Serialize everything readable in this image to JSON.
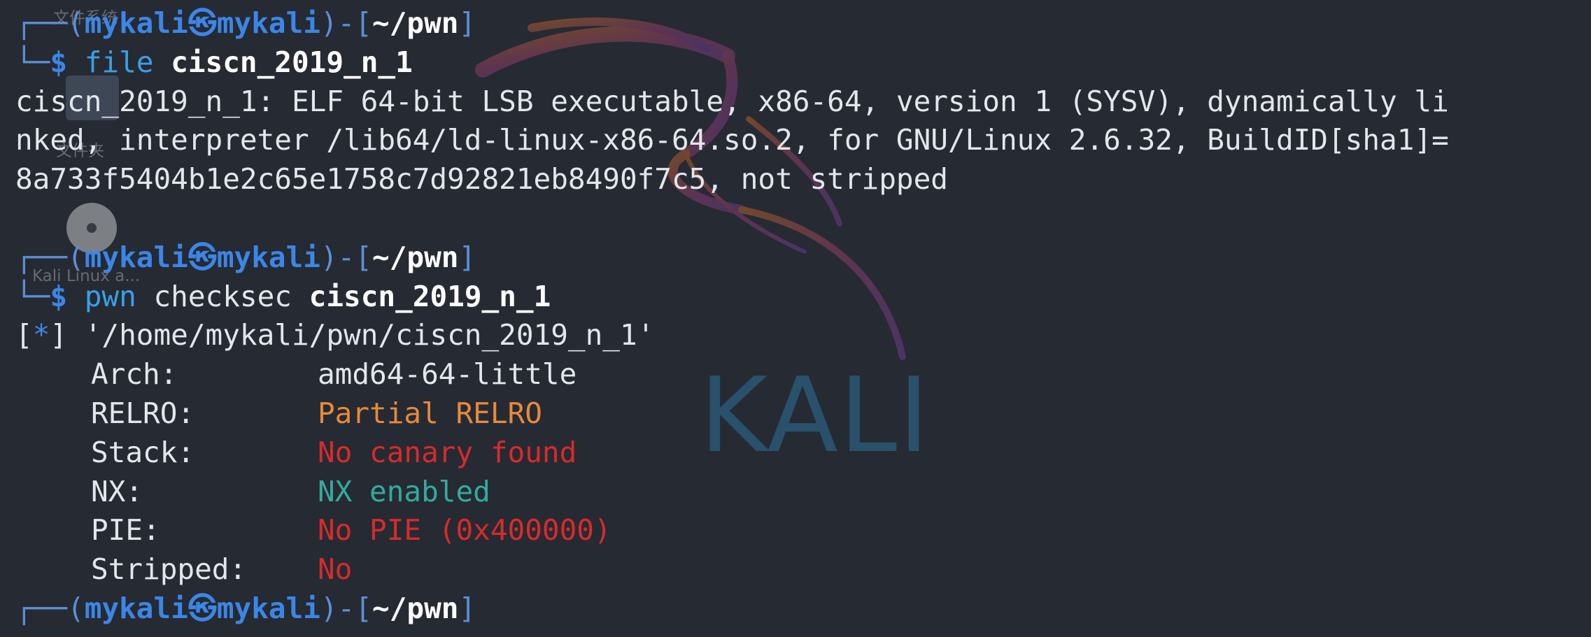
{
  "wallpaper": {
    "brand_text": "KALI",
    "desktop_labels": {
      "filesystem": "文件系统",
      "folder": "文件夹",
      "disc": "Kali Linux a..."
    }
  },
  "prompt": {
    "user": "mykali",
    "at_symbol": "㉿",
    "host": "mykali",
    "cwd": "~/pwn",
    "symbol": "$"
  },
  "commands": [
    {
      "cmd": "file",
      "args": "",
      "target": "ciscn_2019_n_1",
      "output": [
        "ciscn_2019_n_1: ELF 64-bit LSB executable, x86-64, version 1 (SYSV), dynamically li",
        "nked, interpreter /lib64/ld-linux-x86-64.so.2, for GNU/Linux 2.6.32, BuildID[sha1]=",
        "8a733f5404b1e2c65e1758c7d92821eb8490f7c5, not stripped"
      ]
    },
    {
      "cmd": "pwn",
      "args": "checksec",
      "target": "ciscn_2019_n_1"
    }
  ],
  "checksec": {
    "info_marker": "*",
    "path": "'/home/mykali/pwn/ciscn_2019_n_1'",
    "rows": [
      {
        "label": "Arch:",
        "value": "amd64-64-little",
        "color": "#e3e6ea"
      },
      {
        "label": "RELRO:",
        "value": "Partial RELRO",
        "color": "#e58a3c"
      },
      {
        "label": "Stack:",
        "value": "No canary found",
        "color": "#d62b2b"
      },
      {
        "label": "NX:",
        "value": "NX enabled",
        "color": "#33aa9e"
      },
      {
        "label": "PIE:",
        "value": "No PIE (0x400000)",
        "color": "#d62b2b"
      },
      {
        "label": "Stripped:",
        "value": "No",
        "color": "#d62b2b"
      }
    ]
  },
  "colors": {
    "background": "#262a33",
    "prompt_blue": "#3b86e6",
    "text": "#e3e6ea"
  }
}
